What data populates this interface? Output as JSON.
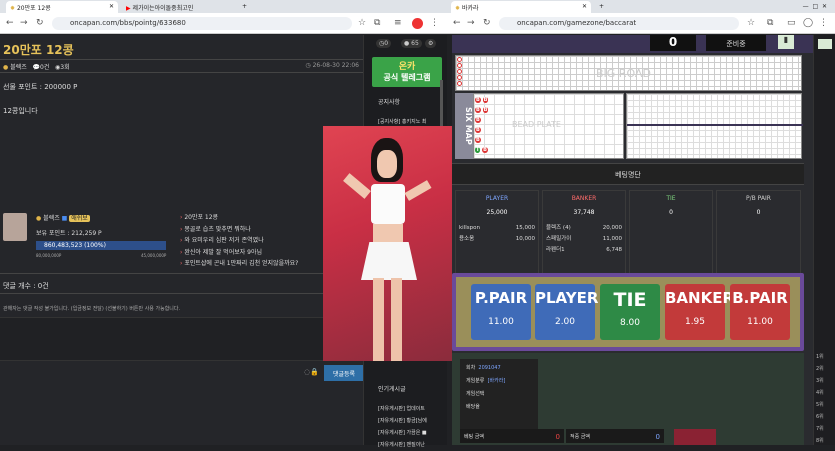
{
  "left": {
    "tabs": [
      {
        "label": "20만포 12콩"
      },
      {
        "label": "제가이는아이돌중최고인"
      }
    ],
    "url": "oncapan.com/bbs/pointg/633680",
    "post": {
      "title": "20만포 12콩",
      "author": "블렉즈",
      "comments": "0건",
      "views": "3회",
      "time": "26-08-30 22:06",
      "gift_points": "선물 포인트 : 200000 P",
      "body": "12콩입니다"
    },
    "profile": {
      "name": "블렉즈",
      "badge": "애쉬보",
      "points": "보유 포인트 : 212,259 P",
      "level_label": "860,483,523 (100%)",
      "range_min": "80,000,000P",
      "range_max": "45,000,000P",
      "level_fill": 1.0,
      "posts": [
        "20만포 12콩",
        "몽골로 습츠 맞추면 뭐하나",
        "와 요미우리 심판 저거 존역였나",
        "완신아 제발 잘 먹어보자 9아님",
        "포인트샵에 곤내 1만짜리 김천 얻지않을까요?"
      ]
    },
    "comment_count": "댓글 개수 : 0건",
    "comment_notice": "관해자는 댓글 작성 불가입니다. (입금정보 전달) (선불하기) 버튼만 사용 가능합니다.",
    "submit": "댓글등록"
  },
  "middle": {
    "stats": [
      "0",
      "65"
    ],
    "banner_line1": "온카",
    "banner_line2": "공식 텔레그램",
    "notice_title": "공지사항",
    "notice_item": "[공지사항] 홍키지노 최",
    "popular_title": "인기게시글",
    "popular_items": [
      "[자유게시판] 업데이트",
      "[자유게시판] 황금[님에",
      "[자유게시판] 가끔은 ■",
      "[자유게시판] 맨질이난"
    ]
  },
  "right": {
    "tabs": [
      {
        "label": "바카라"
      }
    ],
    "url": "oncapan.com/gamezone/baccarat",
    "top_value": "0",
    "top_status": "준비중",
    "big_road": "BIG ROAD",
    "six_map": "SIX MAP",
    "bead_plate": "BEAD PLATE",
    "bead_marks": [
      "B",
      "B",
      "B",
      "B",
      "B",
      "B",
      "B",
      "B",
      "T"
    ],
    "betting_title": "베팅명단",
    "columns": [
      {
        "header": "PLAYER",
        "total": "25,000",
        "color": "#7ea6ff",
        "rows": [
          [
            "killspon",
            "15,000"
          ],
          [
            "용소움",
            "10,000"
          ]
        ]
      },
      {
        "header": "BANKER",
        "total": "37,748",
        "color": "#ff6b6b",
        "rows": [
          [
            "블렉즈 (4)",
            "20,000"
          ],
          [
            "스패밀가이",
            "11,000"
          ],
          [
            "라펜더1",
            "6,748"
          ]
        ]
      },
      {
        "header": "TIE",
        "total": "0",
        "color": "#7fd67f",
        "rows": []
      },
      {
        "header": "P/B PAIR",
        "total": "0",
        "color": "#ccc",
        "rows": []
      }
    ],
    "bets": [
      {
        "label": "P.PAIR",
        "odds": "11.00",
        "color": "#3f6bb8"
      },
      {
        "label": "PLAYER",
        "odds": "2.00",
        "color": "#3f6bb8"
      },
      {
        "label": "TIE",
        "odds": "8.00",
        "color": "#2e8a46"
      },
      {
        "label": "BANKER",
        "odds": "1.95",
        "color": "#c23a3a"
      },
      {
        "label": "B.PAIR",
        "odds": "11.00",
        "color": "#c23a3a"
      }
    ],
    "info": [
      [
        "회차",
        "2091047"
      ],
      [
        "게임분류",
        "[바카라]"
      ],
      [
        "게임선택",
        ""
      ],
      [
        "배당율",
        ""
      ]
    ],
    "bet_amount_label": "베팅 금액",
    "bet_amount": "0",
    "win_amount_label": "적중 금액",
    "win_amount": "0",
    "side_numbers": [
      "1위",
      "2위",
      "3위",
      "4위",
      "5위",
      "6위",
      "7위",
      "8위"
    ]
  }
}
